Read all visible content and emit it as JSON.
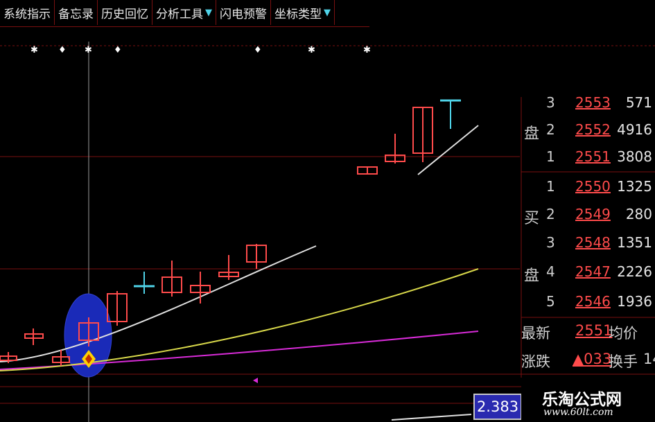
{
  "menu": [
    {
      "label": "系统指示",
      "arrow": false
    },
    {
      "label": "备忘录",
      "arrow": false
    },
    {
      "label": "历史回忆",
      "arrow": false
    },
    {
      "label": "分析工具",
      "arrow": true
    },
    {
      "label": "闪电预警",
      "arrow": false
    },
    {
      "label": "坐标类型",
      "arrow": true
    }
  ],
  "sell_side_label_chars": [
    "盘"
  ],
  "sell_rows": [
    {
      "level": "3",
      "price": "2553",
      "volume": "571"
    },
    {
      "level": "2",
      "price": "2552",
      "volume": "4916"
    },
    {
      "level": "1",
      "price": "2551",
      "volume": "3808"
    }
  ],
  "buy_side_label_chars": [
    "买",
    "盘"
  ],
  "buy_rows": [
    {
      "level": "1",
      "price": "2550",
      "volume": "1325"
    },
    {
      "level": "2",
      "price": "2549",
      "volume": "280"
    },
    {
      "level": "3",
      "price": "2548",
      "volume": "1351"
    },
    {
      "level": "4",
      "price": "2547",
      "volume": "2226"
    },
    {
      "level": "5",
      "price": "2546",
      "volume": "1936"
    }
  ],
  "info": {
    "latest_label": "最新",
    "latest_value": "2551",
    "avg_label": "均价",
    "change_label": "涨跌",
    "change_value": "▲033",
    "turnover_label": "换手",
    "turnover_value": "14"
  },
  "indicator_value": "2.383",
  "watermark": {
    "title": "乐淘公式网",
    "url": "www.60lt.com"
  },
  "colors": {
    "background": "#000000",
    "grid": "#7a1010",
    "up_candle": "#ff4b4b",
    "doji": "#4fd3e8",
    "ma_white": "#e0e0e0",
    "ma_yellow": "#d8d84a",
    "ma_magenta": "#d82bd8",
    "highlight_ellipse": "#1a2ab8",
    "marker": "#ffd000"
  },
  "icons": {
    "signal_marker": "diamond-signal-icon",
    "dropdown": "triangle-down-icon",
    "cursor_marker": "left-triangle-icon"
  }
}
